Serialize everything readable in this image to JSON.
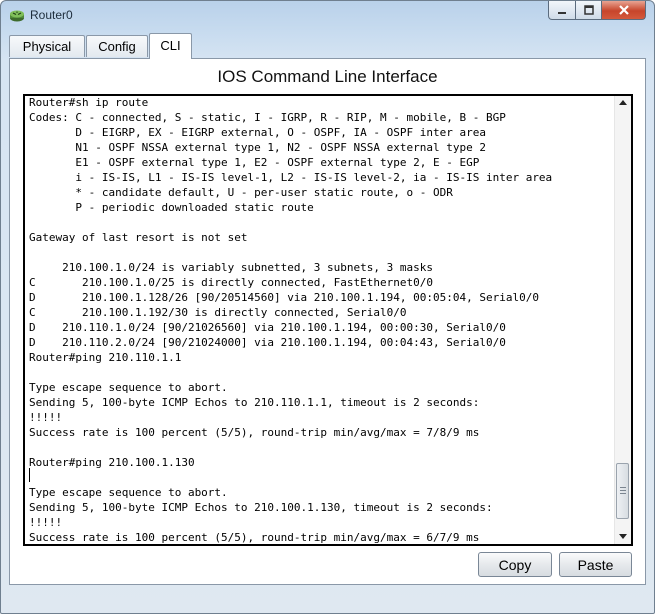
{
  "window": {
    "title": "Router0",
    "icon": "router-icon"
  },
  "tabs": [
    {
      "label": "Physical",
      "active": false
    },
    {
      "label": "Config",
      "active": false
    },
    {
      "label": "CLI",
      "active": true
    }
  ],
  "cli": {
    "heading": "IOS Command Line Interface",
    "lines": [
      "Router#sh ip route",
      "Codes: C - connected, S - static, I - IGRP, R - RIP, M - mobile, B - BGP",
      "       D - EIGRP, EX - EIGRP external, O - OSPF, IA - OSPF inter area",
      "       N1 - OSPF NSSA external type 1, N2 - OSPF NSSA external type 2",
      "       E1 - OSPF external type 1, E2 - OSPF external type 2, E - EGP",
      "       i - IS-IS, L1 - IS-IS level-1, L2 - IS-IS level-2, ia - IS-IS inter area",
      "       * - candidate default, U - per-user static route, o - ODR",
      "       P - periodic downloaded static route",
      "",
      "Gateway of last resort is not set",
      "",
      "     210.100.1.0/24 is variably subnetted, 3 subnets, 3 masks",
      "C       210.100.1.0/25 is directly connected, FastEthernet0/0",
      "D       210.100.1.128/26 [90/20514560] via 210.100.1.194, 00:05:04, Serial0/0",
      "C       210.100.1.192/30 is directly connected, Serial0/0",
      "D    210.110.1.0/24 [90/21026560] via 210.100.1.194, 00:00:30, Serial0/0",
      "D    210.110.2.0/24 [90/21024000] via 210.100.1.194, 00:04:43, Serial0/0",
      "Router#ping 210.110.1.1",
      "",
      "Type escape sequence to abort.",
      "Sending 5, 100-byte ICMP Echos to 210.110.1.1, timeout is 2 seconds:",
      "!!!!!",
      "Success rate is 100 percent (5/5), round-trip min/avg/max = 7/8/9 ms",
      "",
      "Router#ping 210.100.1.130",
      "",
      "Type escape sequence to abort.",
      "Sending 5, 100-byte ICMP Echos to 210.100.1.130, timeout is 2 seconds:",
      "!!!!!",
      "Success rate is 100 percent (5/5), round-trip min/avg/max = 6/7/9 ms"
    ]
  },
  "buttons": {
    "copy": "Copy",
    "paste": "Paste"
  }
}
